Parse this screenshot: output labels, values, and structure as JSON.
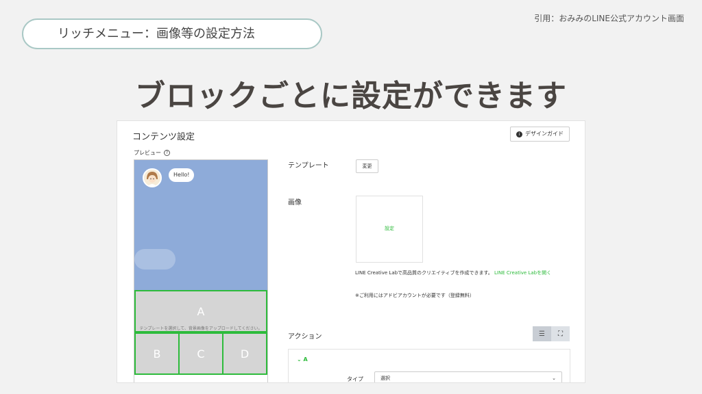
{
  "slide": {
    "section_pill": "リッチメニュー：画像等の設定方法",
    "citation": "引用：おみみのLINE公式アカウント画面",
    "headline": "ブロックごとに設定ができます"
  },
  "panel": {
    "title": "コンテンツ設定",
    "guide_button": "デザインガイド",
    "guide_icon": "info-icon"
  },
  "preview": {
    "label": "プレビュー",
    "bubble_text": "Hello!",
    "chat_bg_color": "#8eabd9",
    "cells": [
      "A",
      "B",
      "C",
      "D"
    ],
    "hint": "テンプレートを選択して、背景画像をアップロードしてください。",
    "accent_color": "#2dbb3b"
  },
  "settings": {
    "template_label": "テンプレート",
    "change_button": "変更",
    "image_label": "画像",
    "image_set": "設定",
    "desc_text": "LINE Creative Labで高品質のクリエイティブを作成できます。",
    "desc_link": "LINE Creative Labを開く",
    "note": "※ご利用にはアドビアカウントが必要です（登録無料）",
    "action_label": "アクション",
    "action_block": "A",
    "type_label": "タイプ",
    "type_value": "選択"
  }
}
